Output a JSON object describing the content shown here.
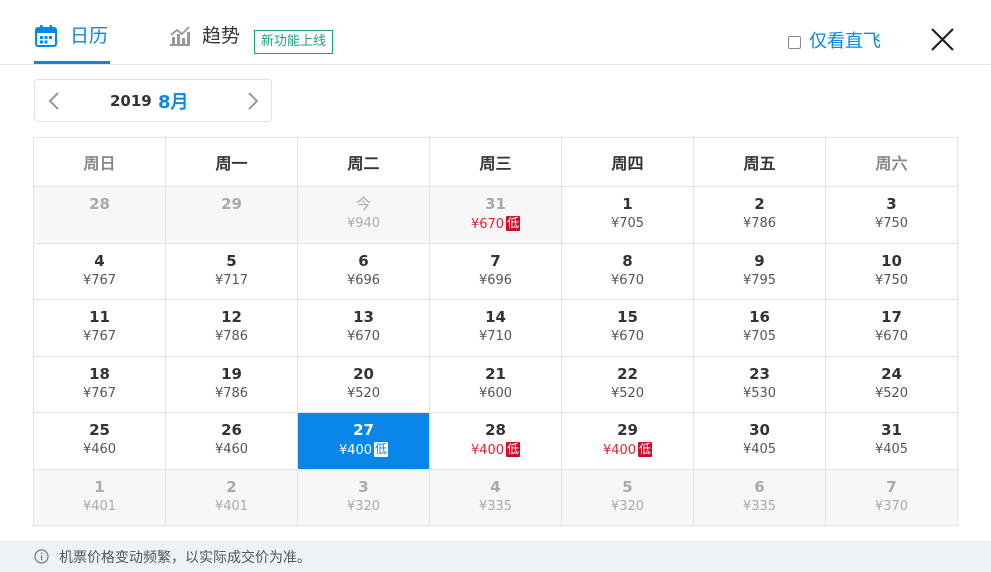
{
  "tabs": {
    "calendar_label": "日历",
    "trend_label": "趋势",
    "new_badge": "新功能上线",
    "calendar_icon": "calendar-icon",
    "trend_icon": "trend-chart-icon"
  },
  "direct_only": {
    "label": "仅看直飞",
    "checked": false
  },
  "month_switch": {
    "year": "2019",
    "month": "8月"
  },
  "weekdays": [
    "周日",
    "周一",
    "周二",
    "周三",
    "周四",
    "周五",
    "周六"
  ],
  "weeks": [
    [
      {
        "day": "28",
        "price": "",
        "state": "disabled"
      },
      {
        "day": "29",
        "price": "",
        "state": "disabled"
      },
      {
        "day": "今",
        "price": "¥940",
        "state": "disabled today"
      },
      {
        "day": "31",
        "price": "¥670",
        "state": "disabled low",
        "tag": "低"
      },
      {
        "day": "1",
        "price": "¥705",
        "state": ""
      },
      {
        "day": "2",
        "price": "¥786",
        "state": ""
      },
      {
        "day": "3",
        "price": "¥750",
        "state": ""
      }
    ],
    [
      {
        "day": "4",
        "price": "¥767",
        "state": ""
      },
      {
        "day": "5",
        "price": "¥717",
        "state": ""
      },
      {
        "day": "6",
        "price": "¥696",
        "state": ""
      },
      {
        "day": "7",
        "price": "¥696",
        "state": ""
      },
      {
        "day": "8",
        "price": "¥670",
        "state": ""
      },
      {
        "day": "9",
        "price": "¥795",
        "state": ""
      },
      {
        "day": "10",
        "price": "¥750",
        "state": ""
      }
    ],
    [
      {
        "day": "11",
        "price": "¥767",
        "state": ""
      },
      {
        "day": "12",
        "price": "¥786",
        "state": ""
      },
      {
        "day": "13",
        "price": "¥670",
        "state": ""
      },
      {
        "day": "14",
        "price": "¥710",
        "state": ""
      },
      {
        "day": "15",
        "price": "¥670",
        "state": ""
      },
      {
        "day": "16",
        "price": "¥705",
        "state": ""
      },
      {
        "day": "17",
        "price": "¥670",
        "state": ""
      }
    ],
    [
      {
        "day": "18",
        "price": "¥767",
        "state": ""
      },
      {
        "day": "19",
        "price": "¥786",
        "state": ""
      },
      {
        "day": "20",
        "price": "¥520",
        "state": ""
      },
      {
        "day": "21",
        "price": "¥600",
        "state": ""
      },
      {
        "day": "22",
        "price": "¥520",
        "state": ""
      },
      {
        "day": "23",
        "price": "¥530",
        "state": ""
      },
      {
        "day": "24",
        "price": "¥520",
        "state": ""
      }
    ],
    [
      {
        "day": "25",
        "price": "¥460",
        "state": ""
      },
      {
        "day": "26",
        "price": "¥460",
        "state": ""
      },
      {
        "day": "27",
        "price": "¥400",
        "state": "selected",
        "tag": "低"
      },
      {
        "day": "28",
        "price": "¥400",
        "state": "low",
        "tag": "低"
      },
      {
        "day": "29",
        "price": "¥400",
        "state": "low",
        "tag": "低"
      },
      {
        "day": "30",
        "price": "¥405",
        "state": ""
      },
      {
        "day": "31",
        "price": "¥405",
        "state": ""
      }
    ],
    [
      {
        "day": "1",
        "price": "¥401",
        "state": "disabled"
      },
      {
        "day": "2",
        "price": "¥401",
        "state": "disabled"
      },
      {
        "day": "3",
        "price": "¥320",
        "state": "disabled"
      },
      {
        "day": "4",
        "price": "¥335",
        "state": "disabled"
      },
      {
        "day": "5",
        "price": "¥320",
        "state": "disabled"
      },
      {
        "day": "6",
        "price": "¥335",
        "state": "disabled"
      },
      {
        "day": "7",
        "price": "¥370",
        "state": "disabled"
      }
    ]
  ],
  "notice": {
    "text": "机票价格变动频繁，以实际成交价为准。",
    "icon": "info-icon"
  },
  "colors": {
    "accent": "#0a86e8",
    "low_price": "#e0242e",
    "low_tag": "#c9102b",
    "badge": "#1aa37a"
  }
}
